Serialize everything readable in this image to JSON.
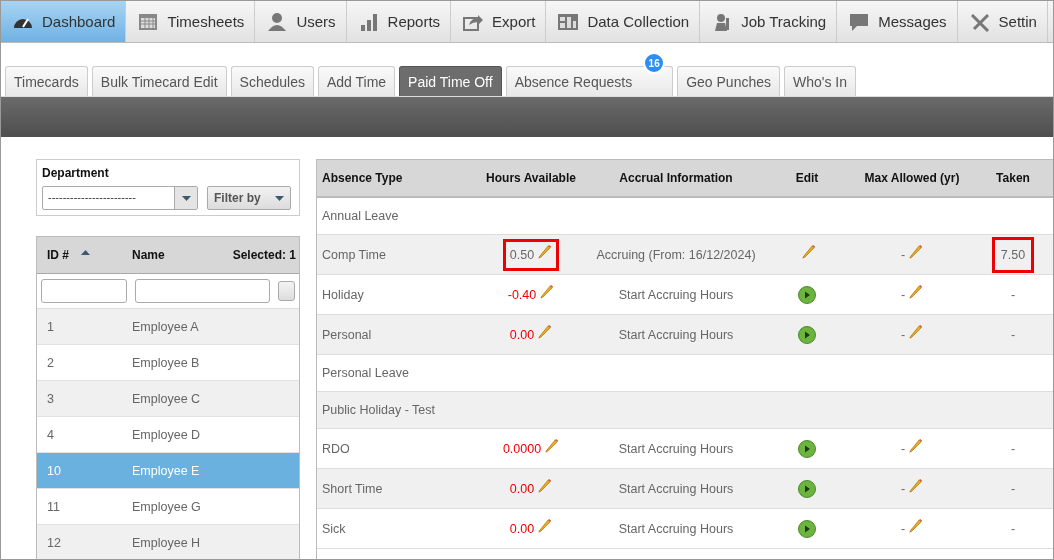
{
  "nav": [
    {
      "label": "Dashboard",
      "selected": true
    },
    {
      "label": "Timesheets",
      "selected": false
    },
    {
      "label": "Users",
      "selected": false
    },
    {
      "label": "Reports",
      "selected": false
    },
    {
      "label": "Export",
      "selected": false
    },
    {
      "label": "Data Collection",
      "selected": false
    },
    {
      "label": "Job Tracking",
      "selected": false
    },
    {
      "label": "Messages",
      "selected": false
    },
    {
      "label": "Settin",
      "selected": false
    }
  ],
  "tabs": [
    {
      "label": "Timecards",
      "selected": false
    },
    {
      "label": "Bulk Timecard Edit",
      "selected": false
    },
    {
      "label": "Schedules",
      "selected": false
    },
    {
      "label": "Add Time",
      "selected": false
    },
    {
      "label": "Paid Time Off",
      "selected": true
    },
    {
      "label": "Absence Requests",
      "selected": false,
      "badge": "16"
    },
    {
      "label": "Geo Punches",
      "selected": false
    },
    {
      "label": "Who's In",
      "selected": false
    }
  ],
  "department": {
    "label": "Department",
    "value": "------------------------",
    "filter": "Filter by"
  },
  "employees": {
    "columns": [
      "ID #",
      "Name"
    ],
    "selected_count": "Selected: 1",
    "rows": [
      {
        "id": "1",
        "name": "Employee A",
        "selected": false
      },
      {
        "id": "2",
        "name": "Employee B",
        "selected": false
      },
      {
        "id": "3",
        "name": "Employee C",
        "selected": false
      },
      {
        "id": "4",
        "name": "Employee D",
        "selected": false
      },
      {
        "id": "10",
        "name": "Employee E",
        "selected": true
      },
      {
        "id": "11",
        "name": "Employee G",
        "selected": false
      },
      {
        "id": "12",
        "name": "Employee H",
        "selected": false
      }
    ]
  },
  "absence": {
    "columns": [
      "Absence Type",
      "Hours Available",
      "Accrual Information",
      "Edit",
      "Max Allowed (yr)",
      "Taken"
    ],
    "rows": [
      {
        "kind": "group",
        "type": "Annual Leave"
      },
      {
        "kind": "entry",
        "type": "Comp Time",
        "hours": "0.50",
        "hours_negative": false,
        "hours_highlighted": true,
        "accrual": "Accruing (From: 16/12/2024)",
        "edit": {
          "kind": "pencil"
        },
        "max": "-",
        "taken": "7.50",
        "taken_highlighted": true
      },
      {
        "kind": "entry",
        "type": "Holiday",
        "hours": "-0.40",
        "hours_negative": true,
        "hours_highlighted": false,
        "accrual": "Start Accruing Hours",
        "edit": {
          "kind": "play"
        },
        "max": "-",
        "taken": "-",
        "taken_highlighted": false
      },
      {
        "kind": "entry",
        "type": "Personal",
        "hours": "0.00",
        "hours_negative": true,
        "hours_highlighted": false,
        "accrual": "Start Accruing Hours",
        "edit": {
          "kind": "play"
        },
        "max": "-",
        "taken": "-",
        "taken_highlighted": false
      },
      {
        "kind": "group",
        "type": "Personal Leave"
      },
      {
        "kind": "group",
        "type": "Public Holiday - Test"
      },
      {
        "kind": "entry",
        "type": "RDO",
        "hours": "0.0000",
        "hours_negative": true,
        "hours_highlighted": false,
        "accrual": "Start Accruing Hours",
        "edit": {
          "kind": "play"
        },
        "max": "-",
        "taken": "-",
        "taken_highlighted": false
      },
      {
        "kind": "entry",
        "type": "Short Time",
        "hours": "0.00",
        "hours_negative": true,
        "hours_highlighted": false,
        "accrual": "Start Accruing Hours",
        "edit": {
          "kind": "play"
        },
        "max": "-",
        "taken": "-",
        "taken_highlighted": false
      },
      {
        "kind": "entry",
        "type": "Sick",
        "hours": "0.00",
        "hours_negative": true,
        "hours_highlighted": false,
        "accrual": "Start Accruing Hours",
        "edit": {
          "kind": "play"
        },
        "max": "-",
        "taken": "-",
        "taken_highlighted": false
      }
    ]
  }
}
